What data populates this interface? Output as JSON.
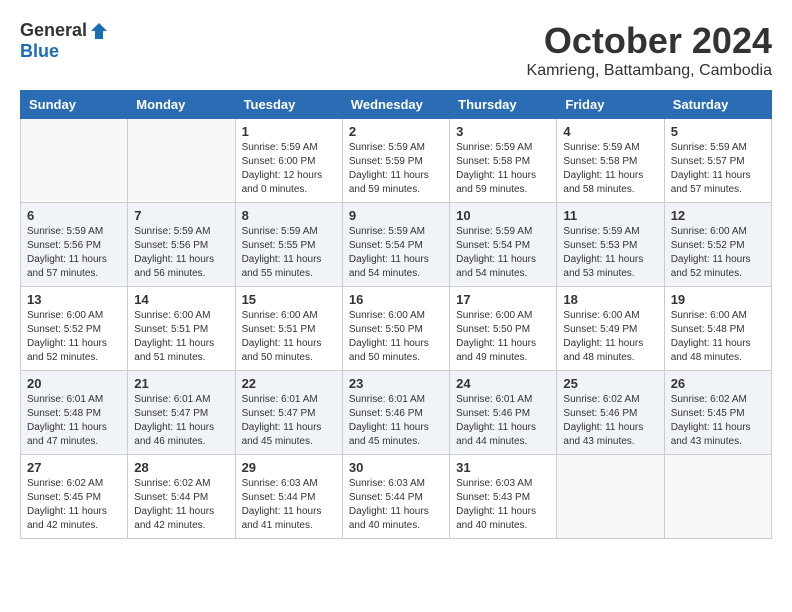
{
  "header": {
    "logo_general": "General",
    "logo_blue": "Blue",
    "month_title": "October 2024",
    "subtitle": "Kamrieng, Battambang, Cambodia"
  },
  "weekdays": [
    "Sunday",
    "Monday",
    "Tuesday",
    "Wednesday",
    "Thursday",
    "Friday",
    "Saturday"
  ],
  "weeks": [
    [
      {
        "day": "",
        "info": ""
      },
      {
        "day": "",
        "info": ""
      },
      {
        "day": "1",
        "info": "Sunrise: 5:59 AM\nSunset: 6:00 PM\nDaylight: 12 hours\nand 0 minutes."
      },
      {
        "day": "2",
        "info": "Sunrise: 5:59 AM\nSunset: 5:59 PM\nDaylight: 11 hours\nand 59 minutes."
      },
      {
        "day": "3",
        "info": "Sunrise: 5:59 AM\nSunset: 5:58 PM\nDaylight: 11 hours\nand 59 minutes."
      },
      {
        "day": "4",
        "info": "Sunrise: 5:59 AM\nSunset: 5:58 PM\nDaylight: 11 hours\nand 58 minutes."
      },
      {
        "day": "5",
        "info": "Sunrise: 5:59 AM\nSunset: 5:57 PM\nDaylight: 11 hours\nand 57 minutes."
      }
    ],
    [
      {
        "day": "6",
        "info": "Sunrise: 5:59 AM\nSunset: 5:56 PM\nDaylight: 11 hours\nand 57 minutes."
      },
      {
        "day": "7",
        "info": "Sunrise: 5:59 AM\nSunset: 5:56 PM\nDaylight: 11 hours\nand 56 minutes."
      },
      {
        "day": "8",
        "info": "Sunrise: 5:59 AM\nSunset: 5:55 PM\nDaylight: 11 hours\nand 55 minutes."
      },
      {
        "day": "9",
        "info": "Sunrise: 5:59 AM\nSunset: 5:54 PM\nDaylight: 11 hours\nand 54 minutes."
      },
      {
        "day": "10",
        "info": "Sunrise: 5:59 AM\nSunset: 5:54 PM\nDaylight: 11 hours\nand 54 minutes."
      },
      {
        "day": "11",
        "info": "Sunrise: 5:59 AM\nSunset: 5:53 PM\nDaylight: 11 hours\nand 53 minutes."
      },
      {
        "day": "12",
        "info": "Sunrise: 6:00 AM\nSunset: 5:52 PM\nDaylight: 11 hours\nand 52 minutes."
      }
    ],
    [
      {
        "day": "13",
        "info": "Sunrise: 6:00 AM\nSunset: 5:52 PM\nDaylight: 11 hours\nand 52 minutes."
      },
      {
        "day": "14",
        "info": "Sunrise: 6:00 AM\nSunset: 5:51 PM\nDaylight: 11 hours\nand 51 minutes."
      },
      {
        "day": "15",
        "info": "Sunrise: 6:00 AM\nSunset: 5:51 PM\nDaylight: 11 hours\nand 50 minutes."
      },
      {
        "day": "16",
        "info": "Sunrise: 6:00 AM\nSunset: 5:50 PM\nDaylight: 11 hours\nand 50 minutes."
      },
      {
        "day": "17",
        "info": "Sunrise: 6:00 AM\nSunset: 5:50 PM\nDaylight: 11 hours\nand 49 minutes."
      },
      {
        "day": "18",
        "info": "Sunrise: 6:00 AM\nSunset: 5:49 PM\nDaylight: 11 hours\nand 48 minutes."
      },
      {
        "day": "19",
        "info": "Sunrise: 6:00 AM\nSunset: 5:48 PM\nDaylight: 11 hours\nand 48 minutes."
      }
    ],
    [
      {
        "day": "20",
        "info": "Sunrise: 6:01 AM\nSunset: 5:48 PM\nDaylight: 11 hours\nand 47 minutes."
      },
      {
        "day": "21",
        "info": "Sunrise: 6:01 AM\nSunset: 5:47 PM\nDaylight: 11 hours\nand 46 minutes."
      },
      {
        "day": "22",
        "info": "Sunrise: 6:01 AM\nSunset: 5:47 PM\nDaylight: 11 hours\nand 45 minutes."
      },
      {
        "day": "23",
        "info": "Sunrise: 6:01 AM\nSunset: 5:46 PM\nDaylight: 11 hours\nand 45 minutes."
      },
      {
        "day": "24",
        "info": "Sunrise: 6:01 AM\nSunset: 5:46 PM\nDaylight: 11 hours\nand 44 minutes."
      },
      {
        "day": "25",
        "info": "Sunrise: 6:02 AM\nSunset: 5:46 PM\nDaylight: 11 hours\nand 43 minutes."
      },
      {
        "day": "26",
        "info": "Sunrise: 6:02 AM\nSunset: 5:45 PM\nDaylight: 11 hours\nand 43 minutes."
      }
    ],
    [
      {
        "day": "27",
        "info": "Sunrise: 6:02 AM\nSunset: 5:45 PM\nDaylight: 11 hours\nand 42 minutes."
      },
      {
        "day": "28",
        "info": "Sunrise: 6:02 AM\nSunset: 5:44 PM\nDaylight: 11 hours\nand 42 minutes."
      },
      {
        "day": "29",
        "info": "Sunrise: 6:03 AM\nSunset: 5:44 PM\nDaylight: 11 hours\nand 41 minutes."
      },
      {
        "day": "30",
        "info": "Sunrise: 6:03 AM\nSunset: 5:44 PM\nDaylight: 11 hours\nand 40 minutes."
      },
      {
        "day": "31",
        "info": "Sunrise: 6:03 AM\nSunset: 5:43 PM\nDaylight: 11 hours\nand 40 minutes."
      },
      {
        "day": "",
        "info": ""
      },
      {
        "day": "",
        "info": ""
      }
    ]
  ]
}
